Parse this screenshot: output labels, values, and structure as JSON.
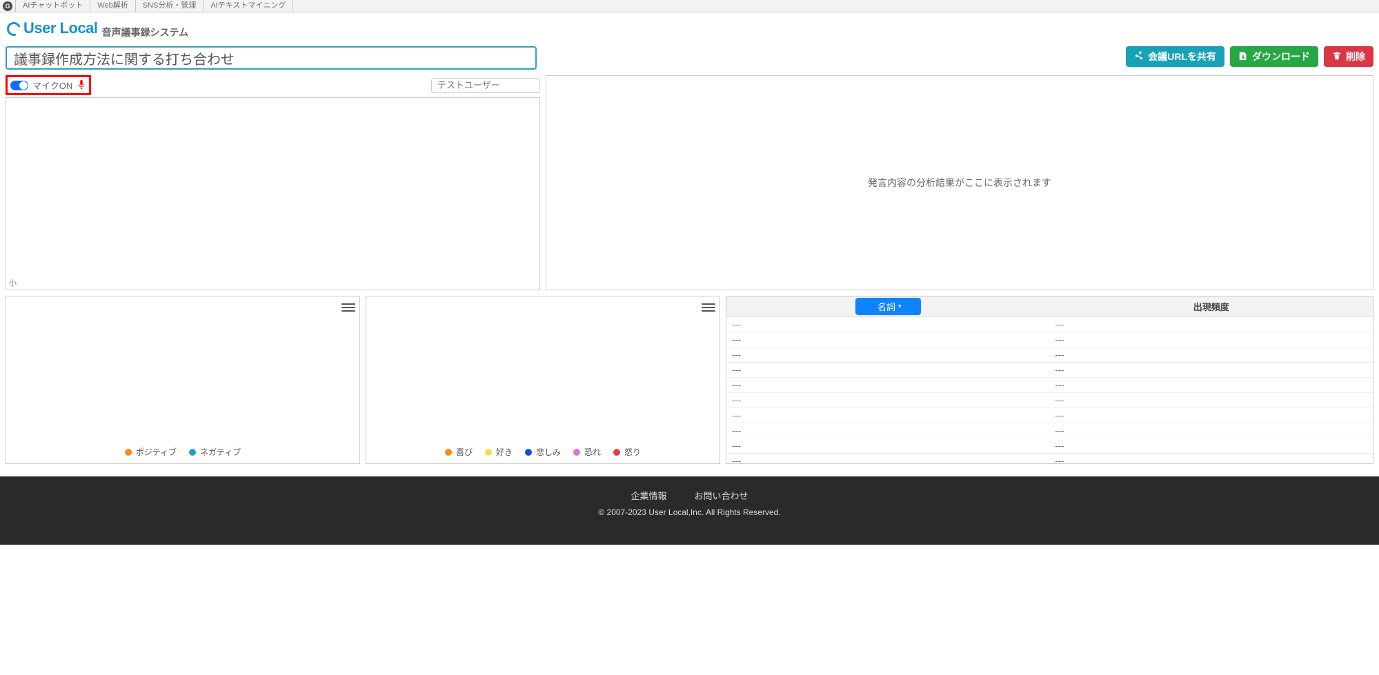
{
  "topnav": {
    "items": [
      "AIチャットボット",
      "Web解析",
      "SNS分析・管理",
      "AIテキストマイニング"
    ]
  },
  "brand": {
    "name": "User Local",
    "sub": "音声議事録システム"
  },
  "meeting": {
    "title_value": "議事録作成方法に関する打ち合わせ"
  },
  "buttons": {
    "share": "会議URLを共有",
    "download": "ダウンロード",
    "delete": "削除"
  },
  "mic": {
    "label": "マイクON"
  },
  "user": {
    "placeholder": "テストユーザー"
  },
  "speech_panel": {
    "resize_mark": "小"
  },
  "analysis": {
    "placeholder": "発言内容の分析結果がここに表示されます"
  },
  "chart1": {
    "legend": [
      {
        "label": "ポジティブ",
        "color": "#ff8c00"
      },
      {
        "label": "ネガティブ",
        "color": "#1f9fcf"
      }
    ]
  },
  "chart2": {
    "legend": [
      {
        "label": "喜び",
        "color": "#ff8c00"
      },
      {
        "label": "好き",
        "color": "#f4e04d"
      },
      {
        "label": "悲しみ",
        "color": "#1050d8"
      },
      {
        "label": "恐れ",
        "color": "#d976d9"
      },
      {
        "label": "怒り",
        "color": "#e04040"
      }
    ]
  },
  "table": {
    "col_noun_label": "名詞",
    "col_freq_label": "出現頻度",
    "rows": [
      {
        "word": "---",
        "freq": "---"
      },
      {
        "word": "---",
        "freq": "---"
      },
      {
        "word": "---",
        "freq": "---"
      },
      {
        "word": "---",
        "freq": "---"
      },
      {
        "word": "---",
        "freq": "---"
      },
      {
        "word": "---",
        "freq": "---"
      },
      {
        "word": "---",
        "freq": "---"
      },
      {
        "word": "---",
        "freq": "---"
      },
      {
        "word": "---",
        "freq": "---"
      },
      {
        "word": "---",
        "freq": "---"
      }
    ]
  },
  "footer": {
    "link1": "企業情報",
    "link2": "お問い合わせ",
    "copyright": "© 2007-2023 User Local,Inc. All Rights Reserved."
  }
}
